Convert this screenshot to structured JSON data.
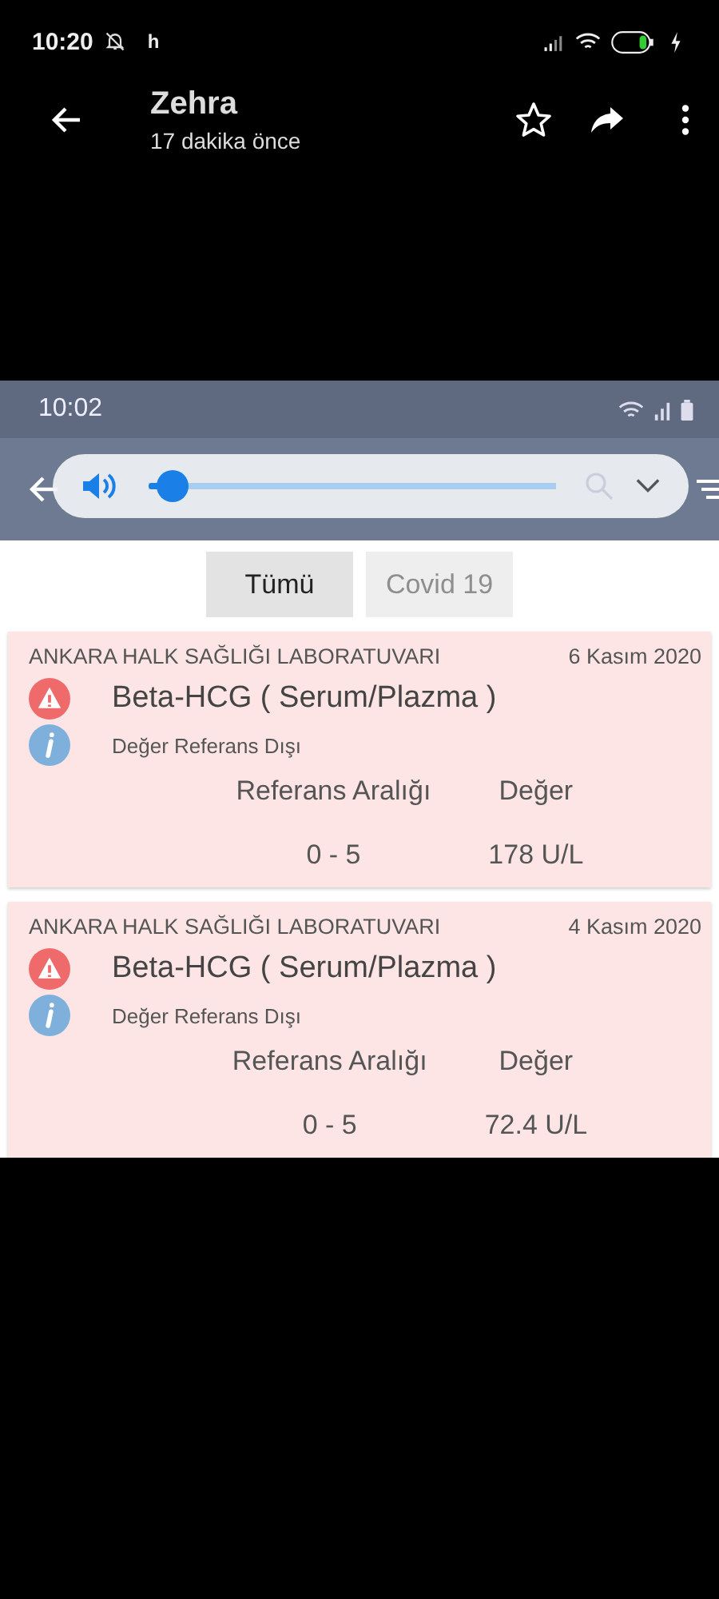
{
  "status_bar": {
    "time": "10:20",
    "extra": "h"
  },
  "viewer": {
    "title": "Zehra",
    "subtitle": "17 dakika önce",
    "starred": false
  },
  "screenshot": {
    "status_bar": {
      "time": "10:02"
    },
    "volume": {
      "level": 0.06
    },
    "filters": [
      {
        "label": "Tümü",
        "selected": true
      },
      {
        "label": "Covid 19",
        "selected": false
      }
    ],
    "results": [
      {
        "lab": "ANKARA HALK SAĞLIĞI LABORATUVARI",
        "date": "6 Kasım 2020",
        "test": "Beta-HCG ( Serum/Plazma )",
        "note": "Değer Referans Dışı",
        "range_label": "Referans Aralığı",
        "value_label": "Değer",
        "range": "0 - 5",
        "value": "178 U/L",
        "abnormal": true
      },
      {
        "lab": "ANKARA HALK SAĞLIĞI LABORATUVARI",
        "date": "4 Kasım 2020",
        "test": "Beta-HCG ( Serum/Plazma )",
        "note": "Değer Referans Dışı",
        "range_label": "Referans Aralığı",
        "value_label": "Değer",
        "range": "0 - 5",
        "value": "72.4 U/L",
        "abnormal": true
      }
    ]
  }
}
